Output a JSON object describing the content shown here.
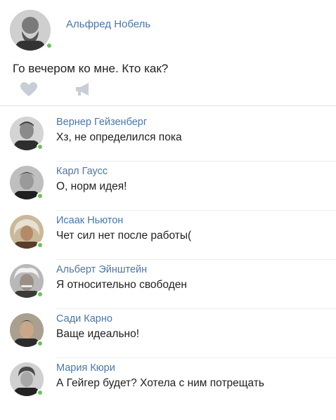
{
  "post": {
    "author": "Альфред Нобель",
    "text": "Го вечером ко мне. Кто как?",
    "online": true,
    "actions": [
      {
        "name": "like",
        "icon": "heart-icon"
      },
      {
        "name": "share",
        "icon": "megaphone-icon"
      }
    ]
  },
  "comments": [
    {
      "author": "Вернер Гейзенберг",
      "text": "Хз, не определился пока",
      "online": true
    },
    {
      "author": "Карл Гаусс",
      "text": "О, норм идея!",
      "online": true
    },
    {
      "author": "Исаак Ньютон",
      "text": "Чет сил нет после работы(",
      "online": true
    },
    {
      "author": "Альберт Эйнштейн",
      "text": "Я относительно свободен",
      "online": true
    },
    {
      "author": "Сади Карно",
      "text": "Ваще идеально!",
      "online": true
    },
    {
      "author": "Мария Кюри",
      "text": "А Гейгер будет? Хотела с ним потрещать",
      "online": true
    }
  ],
  "colors": {
    "author_link": "#4a76a8",
    "online": "#6ac259",
    "icon_gray": "#c7ced6"
  }
}
